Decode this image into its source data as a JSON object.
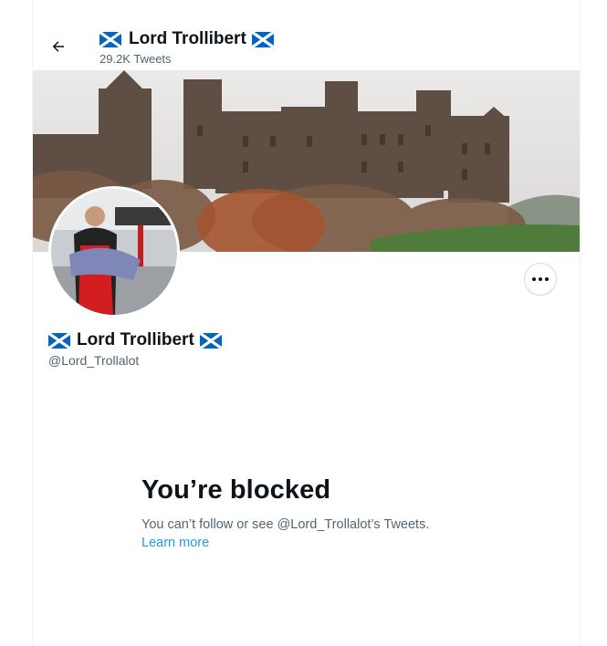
{
  "header": {
    "back_icon": "arrow-left-icon",
    "display_name": "Lord Trollibert",
    "flag_icon": "scotland-flag-icon",
    "tweet_count": "29.2K Tweets"
  },
  "profile": {
    "display_name": "Lord Trollibert",
    "handle": "@Lord_Trollalot",
    "more_icon": "more-dots-icon"
  },
  "blocked": {
    "title": "You’re blocked",
    "description": "You can’t follow or see @Lord_Trollalot’s Tweets.",
    "learn_more": "Learn more"
  },
  "colors": {
    "link": "#1d9bf0",
    "secondary_text": "#536471",
    "primary_text": "#0f1419",
    "flag_blue": "#0065bd"
  }
}
